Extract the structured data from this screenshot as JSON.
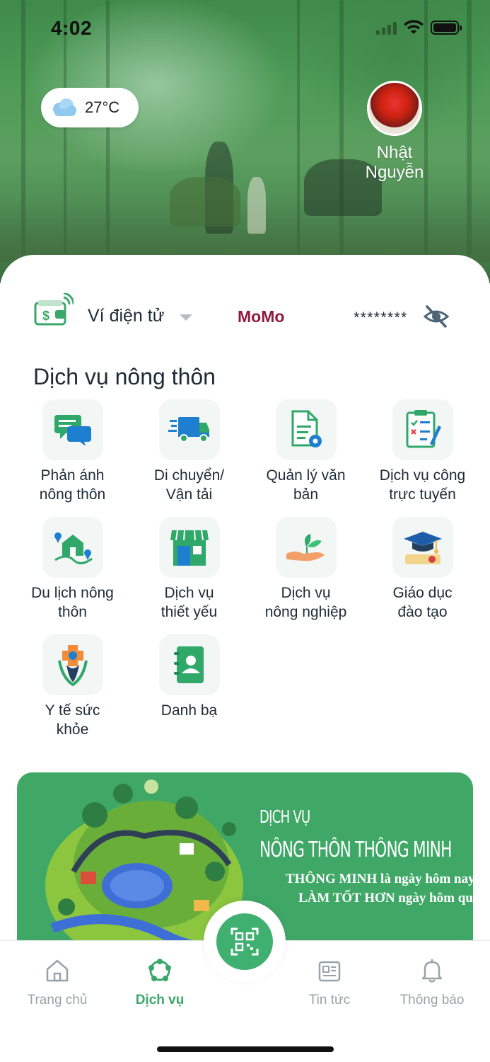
{
  "status_bar": {
    "time": "4:02",
    "icons": [
      "signal-icon",
      "wifi-icon",
      "battery-icon"
    ]
  },
  "weather": {
    "icon": "cloud-icon",
    "temperature": "27°C"
  },
  "profile": {
    "name": "Nhật Nguyễn"
  },
  "wallet": {
    "icon": "wallet-wireless-icon",
    "label": "Ví điện tử",
    "provider": "MoMo",
    "balance": "********",
    "toggle_icon": "eye-off-icon"
  },
  "services": {
    "title": "Dịch vụ nông thôn",
    "items": [
      {
        "label": "Phản ánh\nnông thôn",
        "icon": "chat-bubbles-icon"
      },
      {
        "label": "Di chuyển/\nVận tải",
        "icon": "truck-icon"
      },
      {
        "label": "Quản lý văn\nbản",
        "icon": "document-gear-icon"
      },
      {
        "label": "Dịch vụ công\ntrực tuyến",
        "icon": "checklist-pen-icon"
      },
      {
        "label": "Du lịch nông\nthôn",
        "icon": "map-house-icon"
      },
      {
        "label": "Dịch vụ\nthiết yếu",
        "icon": "storefront-icon"
      },
      {
        "label": "Dịch vụ\nnông nghiệp",
        "icon": "hand-sprout-icon"
      },
      {
        "label": "Giáo dục\nđào tạo",
        "icon": "graduation-cap-icon"
      },
      {
        "label": "Y tế sức\nkhỏe",
        "icon": "health-cross-icon"
      },
      {
        "label": "Danh bạ",
        "icon": "contact-book-icon"
      }
    ]
  },
  "banner": {
    "line1": "DỊCH VỤ",
    "line2": "NÔNG THÔN THÔNG MINH",
    "slogan1": "THÔNG MINH là ngày hôm nay",
    "slogan2": "LÀM TỐT HƠN ngày hôm qua"
  },
  "nav": {
    "items": [
      {
        "label": "Trang chủ",
        "icon": "home-icon"
      },
      {
        "label": "Dịch vụ",
        "icon": "services-icon",
        "active": true
      },
      {
        "label": "Tin tức",
        "icon": "news-icon"
      },
      {
        "label": "Thông báo",
        "icon": "bell-icon"
      }
    ],
    "center_button_icon": "qr-scan-icon"
  },
  "colors": {
    "primary": "#3aa86a",
    "banner": "#40a867",
    "momo": "#8f1d3f",
    "text": "#1e2b36",
    "nav_inactive": "#9aa2a9"
  }
}
